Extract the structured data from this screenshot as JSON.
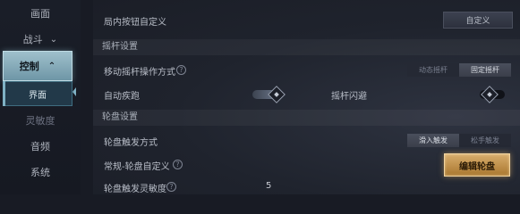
{
  "sidebar": {
    "items": [
      {
        "label": "画面"
      },
      {
        "label": "战斗"
      },
      {
        "label": "控制"
      },
      {
        "label": "界面"
      },
      {
        "label": "灵敏度"
      },
      {
        "label": "音频"
      },
      {
        "label": "系统"
      }
    ]
  },
  "settings": {
    "custom_buttons": {
      "label": "局内按钮自定义",
      "button": "自定义"
    },
    "joystick_section": "摇杆设置",
    "joystick_mode": {
      "label": "移动摇杆操作方式",
      "options": [
        "动态摇杆",
        "固定摇杆"
      ],
      "selected": "固定摇杆"
    },
    "auto_run": {
      "label": "自动疾跑",
      "state": "on"
    },
    "joystick_flash": {
      "label": "摇杆闪避",
      "state": "off"
    },
    "wheel_section": "轮盘设置",
    "wheel_trigger": {
      "label": "轮盘触发方式",
      "options": [
        "滑入触发",
        "松手触发"
      ],
      "selected": "滑入触发"
    },
    "wheel_custom": {
      "label": "常规-轮盘自定义",
      "button": "编辑轮盘"
    },
    "wheel_sensitivity": {
      "label": "轮盘触发灵敏度",
      "value": "5"
    }
  }
}
